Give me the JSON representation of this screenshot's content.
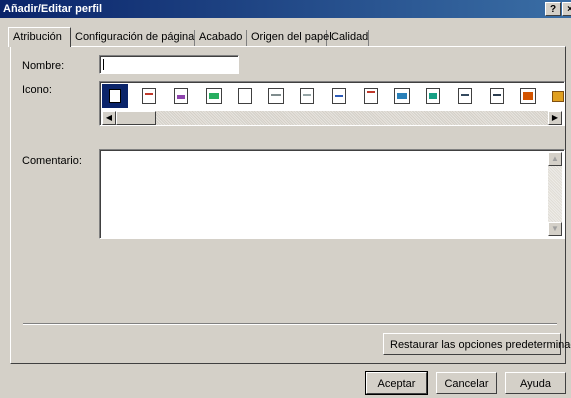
{
  "window": {
    "title": "Añadir/Editar perfil",
    "help_button": "?",
    "close_button": "×"
  },
  "tabs": [
    {
      "label": "Atribución",
      "active": true
    },
    {
      "label": "Configuración de página",
      "active": false
    },
    {
      "label": "Acabado",
      "active": false
    },
    {
      "label": "Origen del papel",
      "active": false
    },
    {
      "label": "Calidad",
      "active": false
    }
  ],
  "form": {
    "name_label": "Nombre:",
    "name_value": "",
    "icon_label": "Icono:",
    "comment_label": "Comentario:",
    "comment_value": "",
    "restore_button": "Restaurar las opciones predeterminadas"
  },
  "icons": [
    "document-icon",
    "text-page-icon",
    "image-page-icon",
    "photo-page-icon",
    "blank-page-icon",
    "layout-page-icon",
    "letter-page-icon",
    "a4-page-icon",
    "notepad-icon",
    "photo-frame-icon",
    "landscape-image-icon",
    "form-page-icon",
    "report-page-icon",
    "gallery-icon",
    "printer-icon"
  ],
  "colors": {
    "title_bar_start": "#0a246a",
    "title_bar_end": "#3a6ea5",
    "selection": "#0a246a",
    "face": "#d4d0c8"
  },
  "footer": {
    "ok_button": "Aceptar",
    "cancel_button": "Cancelar",
    "help_button": "Ayuda"
  }
}
